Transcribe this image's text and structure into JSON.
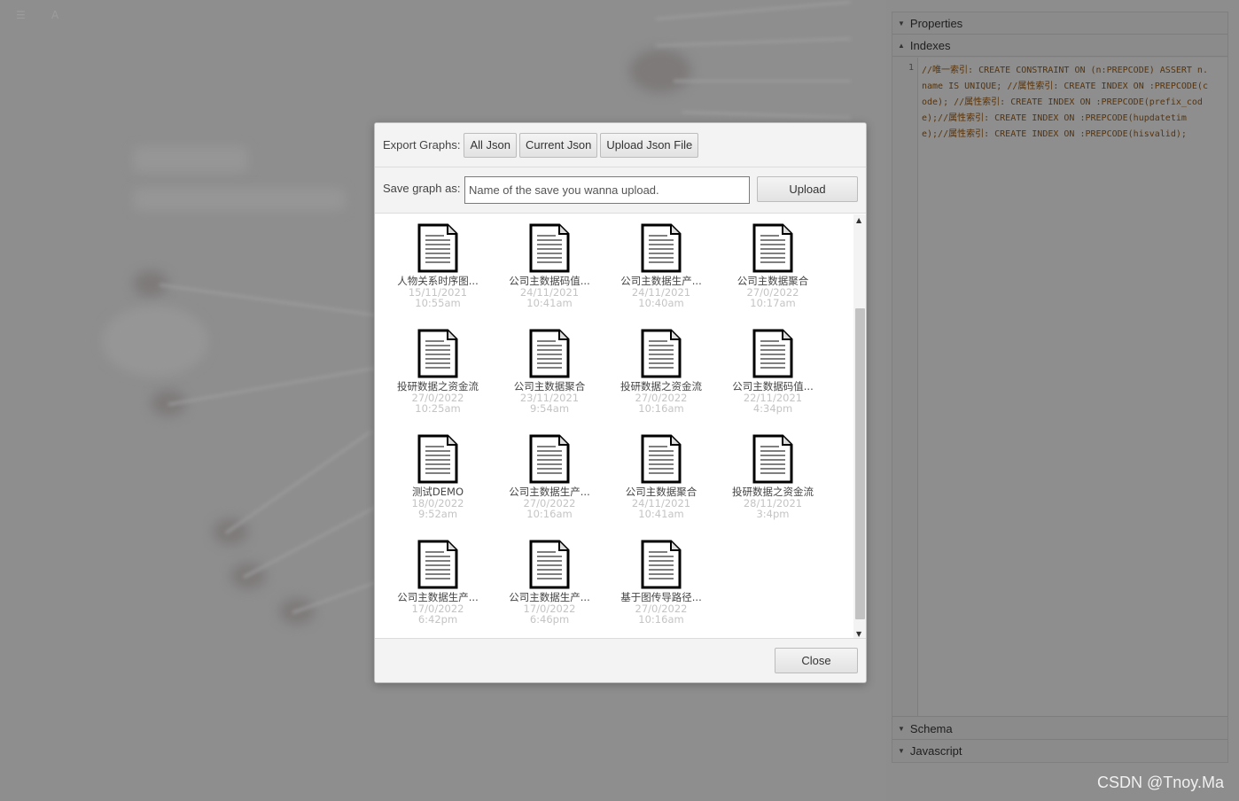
{
  "side_panel": {
    "properties": "Properties",
    "indexes": "Indexes",
    "schema": "Schema",
    "javascript": "Javascript",
    "line_number": "1",
    "code": "//唯一索引: CREATE CONSTRAINT ON (n:PREPCODE) ASSERT n.name IS UNIQUE; //属性索引: CREATE INDEX ON :PREPCODE(code); //属性索引: CREATE INDEX ON :PREPCODE(prefix_code);//属性索引: CREATE INDEX ON :PREPCODE(hupdatetime);//属性索引: CREATE INDEX ON :PREPCODE(hisvalid);"
  },
  "modal": {
    "export_label": "Export Graphs:",
    "buttons": {
      "all_json": "All Json",
      "current_json": "Current Json",
      "upload_json_file": "Upload Json File"
    },
    "save_label": "Save graph as:",
    "save_placeholder": "Name of the save you wanna upload.",
    "upload_label": "Upload",
    "close_label": "Close",
    "files": [
      {
        "name": "人物关系时序图...",
        "date": "15/11/2021",
        "time": "10:55am"
      },
      {
        "name": "公司主数据码值...",
        "date": "24/11/2021",
        "time": "10:41am"
      },
      {
        "name": "公司主数据生产...",
        "date": "24/11/2021",
        "time": "10:40am"
      },
      {
        "name": "公司主数据聚合",
        "date": "27/0/2022",
        "time": "10:17am"
      },
      {
        "name": "投研数据之资金流",
        "date": "27/0/2022",
        "time": "10:25am"
      },
      {
        "name": "公司主数据聚合",
        "date": "23/11/2021",
        "time": "9:54am"
      },
      {
        "name": "投研数据之资金流",
        "date": "27/0/2022",
        "time": "10:16am"
      },
      {
        "name": "公司主数据码值...",
        "date": "22/11/2021",
        "time": "4:34pm"
      },
      {
        "name": "测试DEMO",
        "date": "18/0/2022",
        "time": "9:52am"
      },
      {
        "name": "公司主数据生产...",
        "date": "27/0/2022",
        "time": "10:16am"
      },
      {
        "name": "公司主数据聚合",
        "date": "24/11/2021",
        "time": "10:41am"
      },
      {
        "name": "投研数据之资金流",
        "date": "28/11/2021",
        "time": "3:4pm"
      },
      {
        "name": "公司主数据生产...",
        "date": "17/0/2022",
        "time": "6:42pm"
      },
      {
        "name": "公司主数据生产...",
        "date": "17/0/2022",
        "time": "6:46pm"
      },
      {
        "name": "基于图传导路径...",
        "date": "27/0/2022",
        "time": "10:16am"
      }
    ]
  },
  "icons": {
    "file": "document-icon",
    "expand": "caret-down-icon",
    "collapse": "caret-up-icon"
  },
  "watermark": "CSDN @Tnoy.Ma"
}
